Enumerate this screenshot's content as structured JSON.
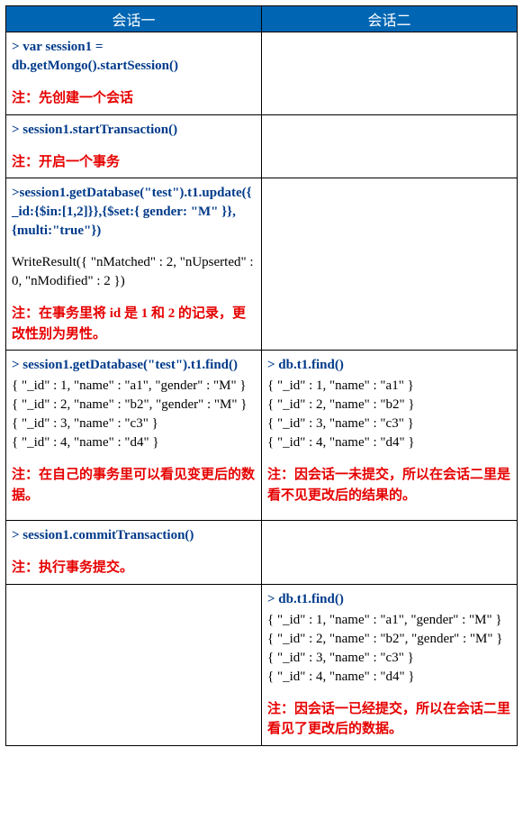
{
  "headers": {
    "col1": "会话一",
    "col2": "会话二"
  },
  "rows": [
    {
      "left": {
        "cmd": "> var session1 = db.getMongo().startSession()",
        "note": "注：先创建一个会话"
      },
      "right": {}
    },
    {
      "left": {
        "cmd": "> session1.startTransaction()",
        "note": "注：开启一个事务"
      },
      "right": {}
    },
    {
      "left": {
        "cmd": ">session1.getDatabase(\"test\").t1.update({_id:{$in:[1,2]}},{$set:{ gender: \"M\" }},{multi:\"true\"})",
        "out": "WriteResult({ \"nMatched\" : 2, \"nUpserted\" : 0, \"nModified\" : 2 })",
        "note": "注：在事务里将 id 是 1 和 2 的记录，更改性别为男性。"
      },
      "right": {}
    },
    {
      "left": {
        "cmd": "> session1.getDatabase(\"test\").t1.find()",
        "out": "{ \"_id\" : 1, \"name\" : \"a1\", \"gender\" : \"M\" }\n{ \"_id\" : 2, \"name\" : \"b2\", \"gender\" : \"M\" }\n{ \"_id\" : 3, \"name\" : \"c3\" }\n{ \"_id\" : 4, \"name\" : \"d4\" }",
        "note": "注：在自己的事务里可以看见变更后的数据。"
      },
      "right": {
        "cmd": "> db.t1.find()",
        "out": "{ \"_id\" : 1, \"name\" : \"a1\" }\n{ \"_id\" : 2, \"name\" : \"b2\" }\n{ \"_id\" : 3, \"name\" : \"c3\" }\n{ \"_id\" : 4, \"name\" : \"d4\" }",
        "note": "注：因会话一未提交，所以在会话二里是看不见更改后的结果的。"
      }
    },
    {
      "left": {
        "cmd": "> session1.commitTransaction()",
        "note": "注：执行事务提交。"
      },
      "right": {}
    },
    {
      "left": {},
      "right": {
        "cmd": "> db.t1.find()",
        "out": "{ \"_id\" : 1, \"name\" : \"a1\", \"gender\" : \"M\" }\n{ \"_id\" : 2, \"name\" : \"b2\", \"gender\" : \"M\" }\n{ \"_id\" : 3, \"name\" : \"c3\" }\n{ \"_id\" : 4, \"name\" : \"d4\" }",
        "note": "注：因会话一已经提交，所以在会话二里看见了更改后的数据。"
      }
    }
  ]
}
